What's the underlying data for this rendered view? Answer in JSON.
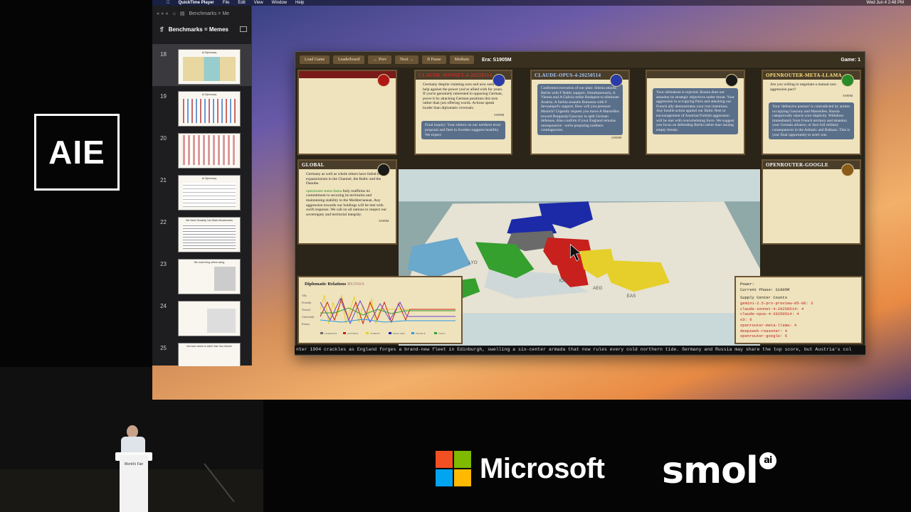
{
  "stage": {
    "logo_text": "AIE",
    "sponsor_microsoft": "Microsoft",
    "sponsor_smol": "smol",
    "sponsor_smol_sup": "ai",
    "podium_label": "World's Fair"
  },
  "menubar": {
    "app": "QuickTime Player",
    "items": [
      "File",
      "Edit",
      "View",
      "Window",
      "Help"
    ],
    "clock": "Wed Jun 4  2:48 PM"
  },
  "keynote": {
    "toolbar_label": "Benchmarks = Me",
    "doc_title": "Benchmarks = Memes",
    "slides": [
      {
        "num": "18",
        "title": "AI Diplomacy"
      },
      {
        "num": "19",
        "title": "AI Diplomacy"
      },
      {
        "num": "20",
        "title": ""
      },
      {
        "num": "21",
        "title": "AI Diplomacy"
      },
      {
        "num": "22",
        "title": "We Need Sociality, Not Static Benchmarks"
      },
      {
        "num": "23",
        "title": "We must bring others along"
      },
      {
        "num": "24",
        "title": ""
      },
      {
        "num": "25",
        "title": "Not sure where to start? Ask Your Moms!"
      }
    ]
  },
  "game": {
    "buttons": [
      "Load Game",
      "Leaderboard",
      "← Prev",
      "Next →",
      "II Pause",
      "Medium"
    ],
    "era": "Era: S1905M",
    "game_no": "Game: 1",
    "cards": {
      "c1": {
        "title": "",
        "body": ""
      },
      "c2": {
        "title": "CLAUDE-SONNET-4-20250514",
        "body": "Germany despite claiming ours and now seek my help against the power you've allied with for years. If you're genuinely interested in opposing German, prove it by attacking German positions this turn rather than just offering words. Actions speak louder than diplomatic reversals.",
        "stamp": "S1905M",
        "bubble": "Final inquiry: Your silence on our northern truce proposal and fleet in Sweden suggests hostility. We expect"
      },
      "c3": {
        "title": "CLAUDE-OPUS-4-20250514",
        "body": "Confirmed execution of our plan: Silesia attacks Berlin with F Baltic support. Simultaneously, A Vienna and A Galicia strike Budapest to eliminate Austria. A Serbia assaults Rumania with F Sevastopol's support. How will you pressure Munich? Urgently request you move A Marseilles toward Burgundy/Gascony to split German defenses. Also confirm if your England remains unresponsive - we're preparing northern contingencies.",
        "stamp": "S1905M"
      },
      "c4": {
        "title": "",
        "body": "Your ultimatum is rejected. Russia does not abandon its strategic objectives under threat. Your aggression in occupying Paris and attacking our French ally demonstrates your true intentions. Any hostile action against our Baltic fleet or encouragement of Austrian/Turkish aggression will be met with overwhelming force. We suggest you focus on defending Berlin rather than issuing empty threats."
      },
      "c5": {
        "title": "OPENROUTER-META-LLAMA",
        "body": "Are you willing to negotiate a mutual non-aggression pact?",
        "stamp": "S1905M",
        "bubble": "Your 'defensive posture' is contradicted by armies occupying Gascony and Marseilles. Russia categorically rejects your duplicity. Withdraw immediately from French territory and abandon your German alliance, or face full military consequences in the Adriatic and Balkans. This is your final opportunity to avert war."
      },
      "global": {
        "title": "GLOBAL",
        "body": "Germany as well as whole others have failed to curb expansionism in the Channel, the Baltic and the Danube.",
        "speaker": "openrouter-meta-llama",
        "body2": "Italy reaffirms its commitment to securing its territories and maintaining stability in the Mediterranean. Any aggression towards our holdings will be met with swift response. We call on all nations to respect our sovereignty and territorial integrity.",
        "stamp": "S1905M"
      },
      "google": {
        "title": "OPENROUTER-GOOGLE",
        "body": ""
      }
    },
    "map_labels": [
      "LYO",
      "ION",
      "AEG",
      "EAS"
    ],
    "diplomatic": {
      "title": "Diplomatic Relations",
      "sub": "RUSSIA",
      "legend": [
        "GERMANY",
        "AUSTRIA",
        "TURKEY",
        "ENGLAND",
        "FRANCE",
        "ITALY"
      ],
      "y_labels": [
        "Ally",
        "Friendly",
        "Neutral",
        "Unfriendly",
        "Enemy"
      ]
    },
    "power": {
      "power_line": "Power:",
      "phase_line": "Current Phase: S1905M",
      "counts_title": "Supply Center Counts",
      "rows": [
        {
          "name": "gemini-2.5-pro-preview-05-06",
          "count": "3"
        },
        {
          "name": "claude-sonnet-4-20250514",
          "count": "4"
        },
        {
          "name": "claude-opus-4-20250514",
          "count": "4"
        },
        {
          "name": "o3",
          "count": "6"
        },
        {
          "name": "openrouter-meta-llama",
          "count": "4"
        },
        {
          "name": "deepseek-reasoner",
          "count": "4"
        },
        {
          "name": "openrouter-google",
          "count": "5"
        }
      ]
    },
    "ticker": "nter 1904 crackles as England forges a brand-new fleet in Edinburgh, swelling a six-center armada that now rules every cold northern tide. Germany and Russia may share the top score, but Austria's col"
  },
  "colors": {
    "panel": "#efe3bd",
    "panel_border": "#6a5436",
    "red": "#c8201c",
    "yellow": "#e6cf2a",
    "green": "#35a02e",
    "blue": "#1c2aa8",
    "gray": "#6a6a6a",
    "water": "#9fc4d8",
    "land": "#e8e2d2"
  }
}
